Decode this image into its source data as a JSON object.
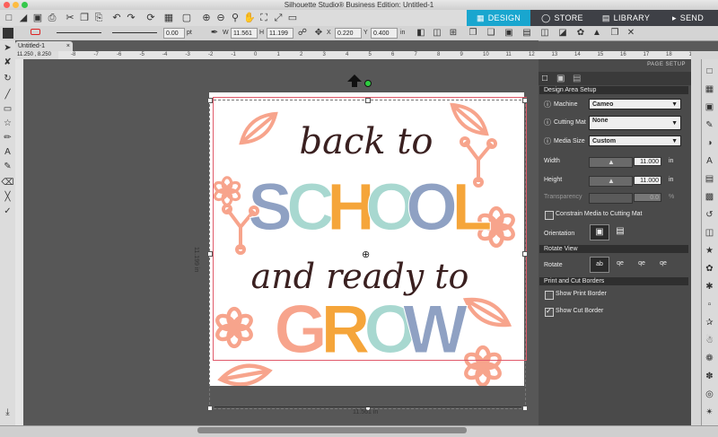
{
  "window": {
    "title": "Silhouette Studio® Business Edition: Untitled-1"
  },
  "nav_tabs": [
    {
      "label": "DESIGN",
      "icon": "grid-icon",
      "active": true
    },
    {
      "label": "STORE",
      "icon": "store-icon",
      "active": false
    },
    {
      "label": "LIBRARY",
      "icon": "library-icon",
      "active": false
    },
    {
      "label": "SEND",
      "icon": "send-icon",
      "active": false
    }
  ],
  "toolbar2": {
    "line_width": "0.00",
    "line_unit": "pt",
    "w_label": "W",
    "w_value": "11.561",
    "h_label": "H",
    "h_value": "11.199",
    "x_label": "X",
    "x_value": "0.220",
    "y_label": "Y",
    "y_value": "0.400",
    "unit": "in"
  },
  "document_tab": {
    "label": "Untitled-1",
    "close": "×"
  },
  "ruler": {
    "coord_readout": "11.250 , 8.250",
    "h_ticks": [
      "-8",
      "-7",
      "-6",
      "-5",
      "-4",
      "-3",
      "-2",
      "-1",
      "0",
      "1",
      "2",
      "3",
      "4",
      "5",
      "6",
      "7",
      "8",
      "9",
      "10",
      "11",
      "12",
      "13",
      "14",
      "15",
      "16",
      "17",
      "18",
      "19"
    ]
  },
  "canvas": {
    "width_dim": "11.561 in",
    "height_dim": "11.199 in",
    "artwork": {
      "line1": "back to",
      "line2_letters": [
        {
          "char": "S",
          "color": "#8fa1c3"
        },
        {
          "char": "C",
          "color": "#a8d8d0"
        },
        {
          "char": "H",
          "color": "#f5a53a"
        },
        {
          "char": "O",
          "color": "#a8d8d0"
        },
        {
          "char": "O",
          "color": "#8fa1c3"
        },
        {
          "char": "L",
          "color": "#f5a53a"
        }
      ],
      "line3": "and ready to",
      "line4_letters": [
        {
          "char": "G",
          "color": "#f7a48c"
        },
        {
          "char": "R",
          "color": "#f5a53a"
        },
        {
          "char": "O",
          "color": "#a8d8d0"
        },
        {
          "char": "W",
          "color": "#8fa1c3"
        }
      ],
      "script_color": "#3a2020",
      "flower_color": "#f7a48c"
    }
  },
  "panel": {
    "title": "PAGE SETUP",
    "section_design_area": "Design Area Setup",
    "machine_label": "Machine",
    "machine_value": "Cameo",
    "cutting_mat_label": "Cutting Mat",
    "cutting_mat_value": "None",
    "media_size_label": "Media Size",
    "media_size_value": "Custom",
    "width_label": "Width",
    "width_value": "11.000",
    "height_label": "Height",
    "height_value": "11.000",
    "unit_in": "in",
    "transparency_label": "Transparency",
    "transparency_value": "0.0",
    "transparency_unit": "%",
    "constrain_label": "Constrain Media to Cutting Mat",
    "orientation_label": "Orientation",
    "section_rotate": "Rotate View",
    "rotate_label": "Rotate",
    "rotate_options": [
      "ab",
      "qe",
      "qe",
      "qe"
    ],
    "section_borders": "Print and Cut Borders",
    "show_print_border_label": "Show Print Border",
    "show_cut_border_label": "Show Cut Border",
    "show_print_border": false,
    "show_cut_border": true
  },
  "colors": {
    "accent": "#19a6cf",
    "panel_bg": "#4a4a4a",
    "canvas_bg": "#575757",
    "cut_border": "#e05a6a"
  }
}
